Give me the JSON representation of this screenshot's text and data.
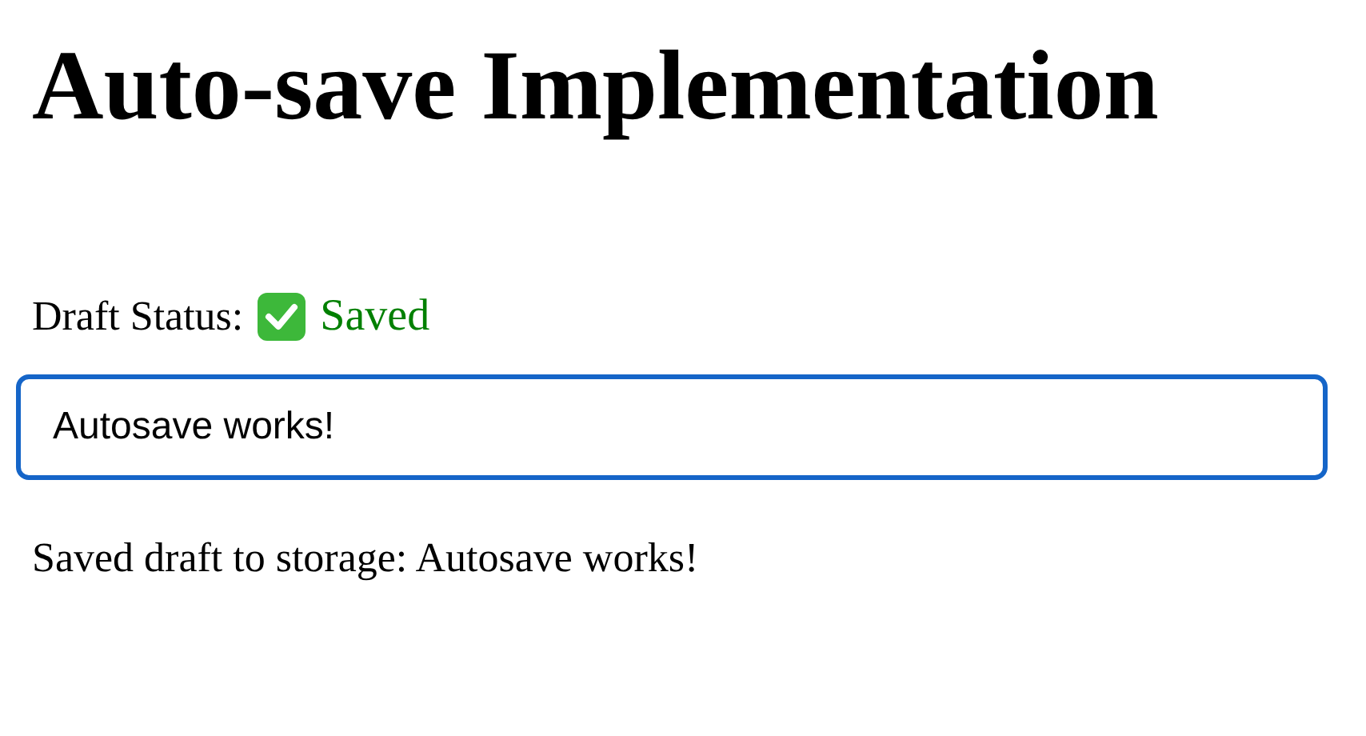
{
  "title": "Auto-save Implementation",
  "status": {
    "label": "Draft Status:",
    "text": "Saved",
    "saved": true
  },
  "field": {
    "value": "Autosave works!",
    "focused": true
  },
  "message": "Saved draft to storage: Autosave works!"
}
